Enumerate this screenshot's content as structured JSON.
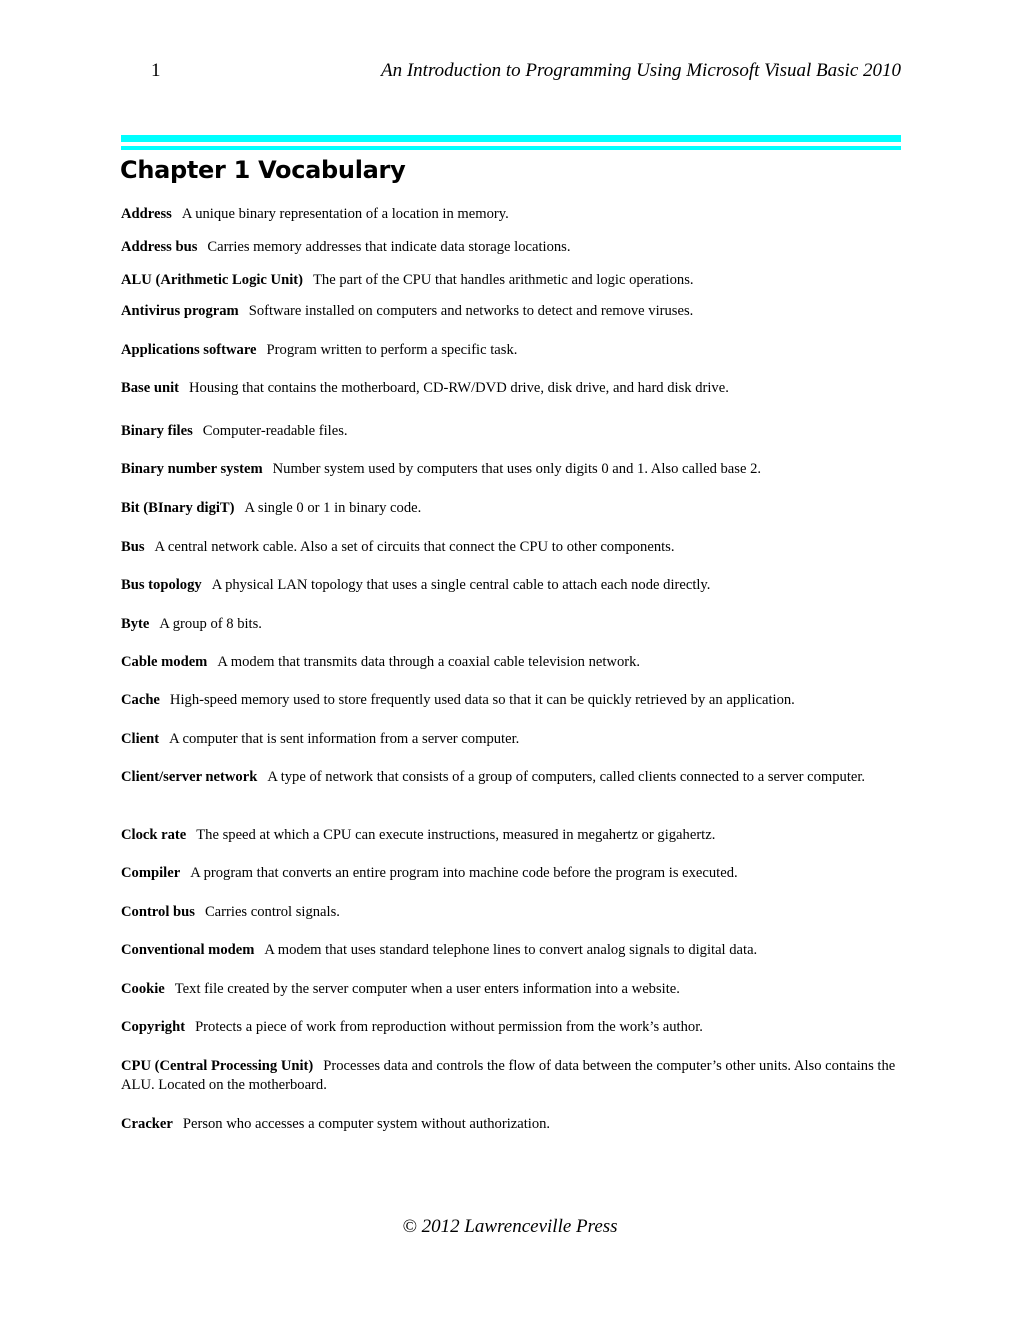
{
  "header": {
    "page_number": "1",
    "book_title": "An Introduction to Programming Using Microsoft Visual Basic 2010"
  },
  "chapter": {
    "title": "Chapter 1 Vocabulary"
  },
  "accent_color": "#00ffff",
  "entries": [
    {
      "term": "Address",
      "definition": "A unique binary representation of a location in memory."
    },
    {
      "term": "Address bus",
      "definition": "Carries memory addresses that indicate data storage locations."
    },
    {
      "term": "ALU (Arithmetic Logic Unit)",
      "definition": "The part of the CPU that handles arithmetic and logic operations."
    },
    {
      "term": "Antivirus program",
      "definition": "Software installed on computers and networks to detect and remove viruses."
    },
    {
      "term": "Applications software",
      "definition": "Program written to perform a specific task."
    },
    {
      "term": "Base unit",
      "definition": "Housing that contains the motherboard, CD-RW/DVD drive, disk drive, and hard disk drive."
    },
    {
      "term": "Binary files",
      "definition": "Computer-readable files."
    },
    {
      "term": "Binary number system",
      "definition": "Number system used by computers that uses only digits 0 and 1. Also called base 2."
    },
    {
      "term": "Bit (BInary digiT)",
      "definition": "A single 0 or 1 in binary code."
    },
    {
      "term": "Bus",
      "definition": "A central network cable. Also a set of circuits that connect the CPU to other components."
    },
    {
      "term": "Bus topology",
      "definition": "A physical LAN topology that uses a single central cable to attach each node directly."
    },
    {
      "term": "Byte",
      "definition": "A group of 8 bits."
    },
    {
      "term": "Cable modem",
      "definition": "A modem that transmits data through a coaxial cable television network."
    },
    {
      "term": "Cache",
      "definition": "High-speed memory used to store frequently used data so that it can be quickly retrieved by an application."
    },
    {
      "term": "Client",
      "definition": "A computer that is sent information from a server computer."
    },
    {
      "term": "Client/server network",
      "definition": "A type of network that consists of a group of computers, called clients connected to a server computer."
    },
    {
      "term": "Clock rate",
      "definition": "The speed at which a CPU can execute instructions, measured in megahertz or gigahertz."
    },
    {
      "term": "Compiler",
      "definition": "A program that converts an entire program into machine code before the program is executed."
    },
    {
      "term": "Control bus",
      "definition": "Carries control signals."
    },
    {
      "term": "Conventional modem",
      "definition": "A modem that uses standard telephone lines to convert analog signals to digital data."
    },
    {
      "term": "Cookie",
      "definition": "Text file created by the server computer when a user enters information into a website."
    },
    {
      "term": "Copyright",
      "definition": "Protects a piece of work from reproduction without permission from the work’s author."
    },
    {
      "term": "CPU (Central Processing Unit)",
      "definition": "Processes data and controls the flow of data between the computer’s other units. Also contains the ALU. Located on the motherboard."
    },
    {
      "term": "Cracker",
      "definition": "Person who accesses a computer system without authorization."
    }
  ],
  "footer": {
    "copyright": "© 2012 Lawrenceville Press"
  }
}
